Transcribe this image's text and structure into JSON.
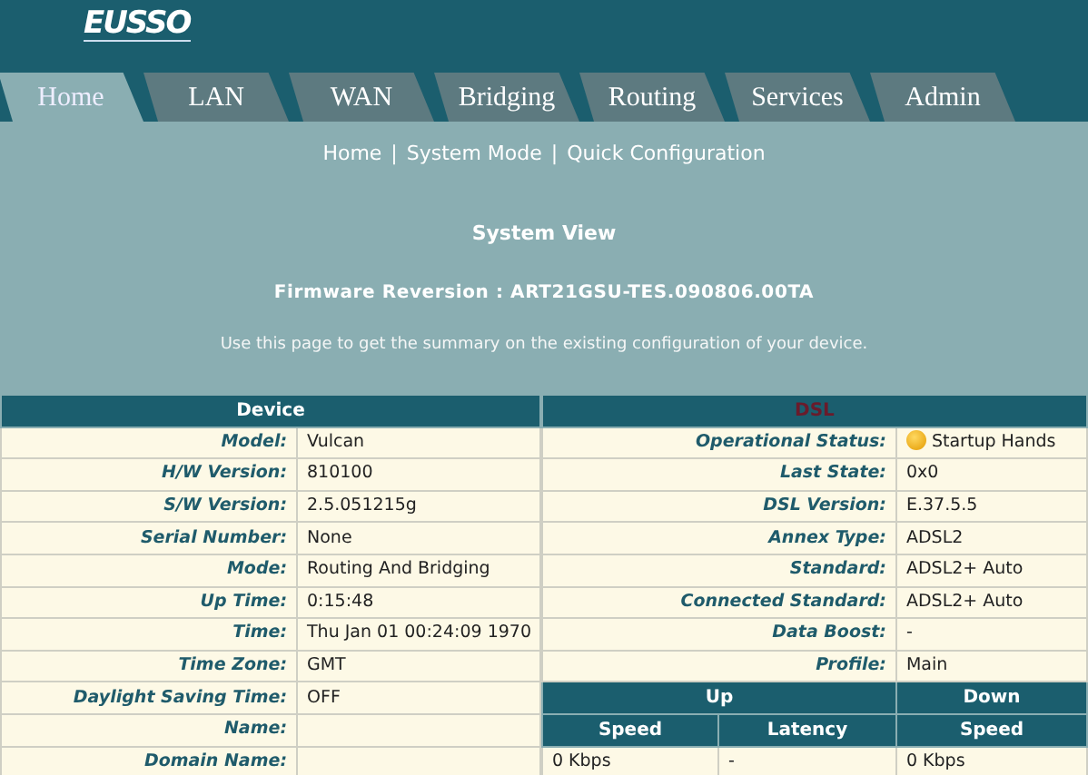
{
  "logo": "EUSSO",
  "tabs": [
    {
      "label": "Home",
      "selected": true
    },
    {
      "label": "LAN",
      "selected": false
    },
    {
      "label": "WAN",
      "selected": false
    },
    {
      "label": "Bridging",
      "selected": false
    },
    {
      "label": "Routing",
      "selected": false
    },
    {
      "label": "Services",
      "selected": false
    },
    {
      "label": "Admin",
      "selected": false
    }
  ],
  "subnav": {
    "links": [
      "Home",
      "System Mode",
      "Quick Configuration"
    ],
    "separator": "|"
  },
  "page_title": "System View",
  "firmware": "Firmware Reversion : ART21GSU-TES.090806.00TA",
  "description": "Use this page to get the summary on the existing configuration of your device.",
  "device": {
    "title": "Device",
    "rows": [
      {
        "label": "Model:",
        "value": "Vulcan"
      },
      {
        "label": "H/W Version:",
        "value": "810100"
      },
      {
        "label": "S/W Version:",
        "value": "2.5.051215g"
      },
      {
        "label": "Serial Number:",
        "value": "None"
      },
      {
        "label": "Mode:",
        "value": "Routing And Bridging"
      },
      {
        "label": "Up Time:",
        "value": "0:15:48"
      },
      {
        "label": "Time:",
        "value": "Thu Jan 01 00:24:09 1970"
      },
      {
        "label": "Time Zone:",
        "value": "GMT"
      },
      {
        "label": "Daylight Saving Time:",
        "value": "OFF"
      },
      {
        "label": "Name:"
      },
      {
        "label": "Domain Name:"
      }
    ]
  },
  "dsl": {
    "title": "DSL",
    "rows": [
      {
        "kind": "status",
        "label": "Operational Status:",
        "value": "Startup Hands"
      },
      {
        "kind": "text",
        "label": "Last State:",
        "value": "0x0"
      },
      {
        "kind": "text",
        "label": "DSL Version:",
        "value": "E.37.5.5"
      },
      {
        "kind": "text",
        "label": "Annex Type:",
        "value": "ADSL2"
      },
      {
        "kind": "text",
        "label": "Standard:",
        "value": "ADSL2+ Auto"
      },
      {
        "kind": "text",
        "label": "Connected Standard:",
        "value": "ADSL2+ Auto"
      },
      {
        "kind": "text",
        "label": "Data Boost:",
        "value": "-"
      },
      {
        "kind": "text",
        "label": "Profile:",
        "value": "Main"
      }
    ]
  },
  "rates": {
    "groups": [
      "Up",
      "Down"
    ],
    "columns": [
      "Speed",
      "Latency",
      "Speed"
    ],
    "rows": [
      [
        "0 Kbps",
        "-",
        "0 Kbps"
      ]
    ]
  }
}
